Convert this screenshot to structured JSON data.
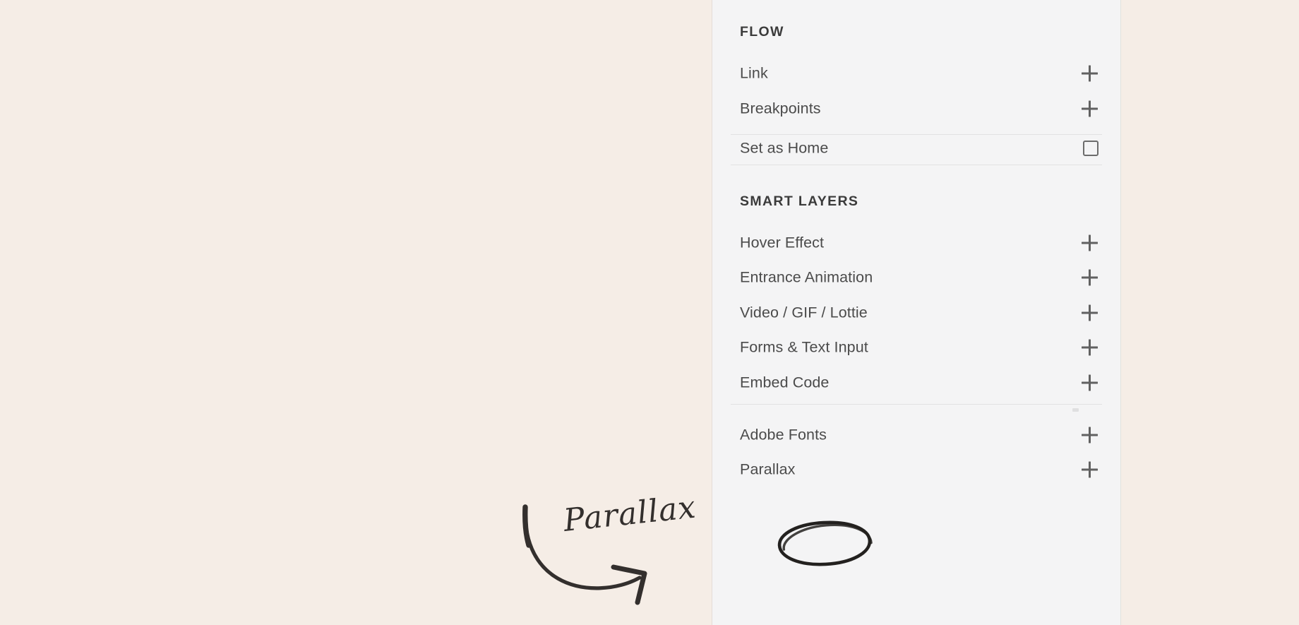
{
  "canvas": {
    "background_color": "#f5ede6"
  },
  "panel": {
    "background_color": "#f4f4f5",
    "sections": [
      {
        "title": "FLOW",
        "rows": [
          {
            "label": "Link",
            "control": "plus-icon"
          },
          {
            "label": "Breakpoints",
            "control": "plus-icon"
          },
          {
            "label": "Set as Home",
            "control": "checkbox-icon",
            "checked": false
          }
        ]
      },
      {
        "title": "SMART LAYERS",
        "rows": [
          {
            "label": "Hover Effect",
            "control": "plus-icon"
          },
          {
            "label": "Entrance Animation",
            "control": "plus-icon"
          },
          {
            "label": "Video / GIF / Lottie",
            "control": "plus-icon"
          },
          {
            "label": "Forms & Text Input",
            "control": "plus-icon"
          },
          {
            "label": "Embed Code",
            "control": "plus-icon"
          }
        ]
      },
      {
        "title": "",
        "rows": [
          {
            "label": "Adobe Fonts",
            "control": "plus-icon"
          },
          {
            "label": "Parallax",
            "control": "plus-icon",
            "highlighted": true
          }
        ]
      }
    ]
  },
  "annotation": {
    "handwritten_label": "Parallax",
    "ink_color": "#332f2d",
    "highlight_shape": "ellipse",
    "pointer_shape": "curved-arrow"
  }
}
